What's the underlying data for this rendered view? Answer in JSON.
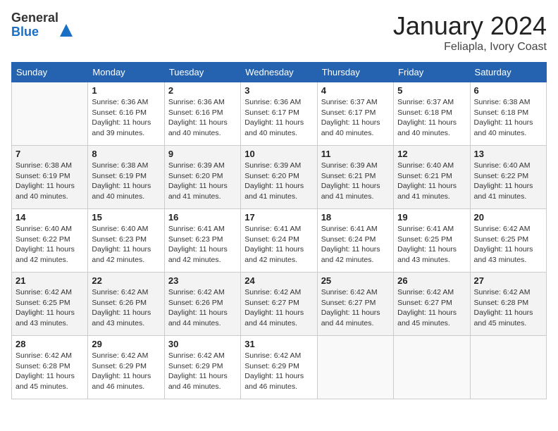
{
  "header": {
    "logo": {
      "general": "General",
      "blue": "Blue"
    },
    "title": "January 2024",
    "location": "Feliapla, Ivory Coast"
  },
  "weekdays": [
    "Sunday",
    "Monday",
    "Tuesday",
    "Wednesday",
    "Thursday",
    "Friday",
    "Saturday"
  ],
  "weeks": [
    [
      {
        "day": "",
        "sunrise": "",
        "sunset": "",
        "daylight": ""
      },
      {
        "day": "1",
        "sunrise": "Sunrise: 6:36 AM",
        "sunset": "Sunset: 6:16 PM",
        "daylight": "Daylight: 11 hours and 39 minutes."
      },
      {
        "day": "2",
        "sunrise": "Sunrise: 6:36 AM",
        "sunset": "Sunset: 6:16 PM",
        "daylight": "Daylight: 11 hours and 40 minutes."
      },
      {
        "day": "3",
        "sunrise": "Sunrise: 6:36 AM",
        "sunset": "Sunset: 6:17 PM",
        "daylight": "Daylight: 11 hours and 40 minutes."
      },
      {
        "day": "4",
        "sunrise": "Sunrise: 6:37 AM",
        "sunset": "Sunset: 6:17 PM",
        "daylight": "Daylight: 11 hours and 40 minutes."
      },
      {
        "day": "5",
        "sunrise": "Sunrise: 6:37 AM",
        "sunset": "Sunset: 6:18 PM",
        "daylight": "Daylight: 11 hours and 40 minutes."
      },
      {
        "day": "6",
        "sunrise": "Sunrise: 6:38 AM",
        "sunset": "Sunset: 6:18 PM",
        "daylight": "Daylight: 11 hours and 40 minutes."
      }
    ],
    [
      {
        "day": "7",
        "sunrise": "Sunrise: 6:38 AM",
        "sunset": "Sunset: 6:19 PM",
        "daylight": "Daylight: 11 hours and 40 minutes."
      },
      {
        "day": "8",
        "sunrise": "Sunrise: 6:38 AM",
        "sunset": "Sunset: 6:19 PM",
        "daylight": "Daylight: 11 hours and 40 minutes."
      },
      {
        "day": "9",
        "sunrise": "Sunrise: 6:39 AM",
        "sunset": "Sunset: 6:20 PM",
        "daylight": "Daylight: 11 hours and 41 minutes."
      },
      {
        "day": "10",
        "sunrise": "Sunrise: 6:39 AM",
        "sunset": "Sunset: 6:20 PM",
        "daylight": "Daylight: 11 hours and 41 minutes."
      },
      {
        "day": "11",
        "sunrise": "Sunrise: 6:39 AM",
        "sunset": "Sunset: 6:21 PM",
        "daylight": "Daylight: 11 hours and 41 minutes."
      },
      {
        "day": "12",
        "sunrise": "Sunrise: 6:40 AM",
        "sunset": "Sunset: 6:21 PM",
        "daylight": "Daylight: 11 hours and 41 minutes."
      },
      {
        "day": "13",
        "sunrise": "Sunrise: 6:40 AM",
        "sunset": "Sunset: 6:22 PM",
        "daylight": "Daylight: 11 hours and 41 minutes."
      }
    ],
    [
      {
        "day": "14",
        "sunrise": "Sunrise: 6:40 AM",
        "sunset": "Sunset: 6:22 PM",
        "daylight": "Daylight: 11 hours and 42 minutes."
      },
      {
        "day": "15",
        "sunrise": "Sunrise: 6:40 AM",
        "sunset": "Sunset: 6:23 PM",
        "daylight": "Daylight: 11 hours and 42 minutes."
      },
      {
        "day": "16",
        "sunrise": "Sunrise: 6:41 AM",
        "sunset": "Sunset: 6:23 PM",
        "daylight": "Daylight: 11 hours and 42 minutes."
      },
      {
        "day": "17",
        "sunrise": "Sunrise: 6:41 AM",
        "sunset": "Sunset: 6:24 PM",
        "daylight": "Daylight: 11 hours and 42 minutes."
      },
      {
        "day": "18",
        "sunrise": "Sunrise: 6:41 AM",
        "sunset": "Sunset: 6:24 PM",
        "daylight": "Daylight: 11 hours and 42 minutes."
      },
      {
        "day": "19",
        "sunrise": "Sunrise: 6:41 AM",
        "sunset": "Sunset: 6:25 PM",
        "daylight": "Daylight: 11 hours and 43 minutes."
      },
      {
        "day": "20",
        "sunrise": "Sunrise: 6:42 AM",
        "sunset": "Sunset: 6:25 PM",
        "daylight": "Daylight: 11 hours and 43 minutes."
      }
    ],
    [
      {
        "day": "21",
        "sunrise": "Sunrise: 6:42 AM",
        "sunset": "Sunset: 6:25 PM",
        "daylight": "Daylight: 11 hours and 43 minutes."
      },
      {
        "day": "22",
        "sunrise": "Sunrise: 6:42 AM",
        "sunset": "Sunset: 6:26 PM",
        "daylight": "Daylight: 11 hours and 43 minutes."
      },
      {
        "day": "23",
        "sunrise": "Sunrise: 6:42 AM",
        "sunset": "Sunset: 6:26 PM",
        "daylight": "Daylight: 11 hours and 44 minutes."
      },
      {
        "day": "24",
        "sunrise": "Sunrise: 6:42 AM",
        "sunset": "Sunset: 6:27 PM",
        "daylight": "Daylight: 11 hours and 44 minutes."
      },
      {
        "day": "25",
        "sunrise": "Sunrise: 6:42 AM",
        "sunset": "Sunset: 6:27 PM",
        "daylight": "Daylight: 11 hours and 44 minutes."
      },
      {
        "day": "26",
        "sunrise": "Sunrise: 6:42 AM",
        "sunset": "Sunset: 6:27 PM",
        "daylight": "Daylight: 11 hours and 45 minutes."
      },
      {
        "day": "27",
        "sunrise": "Sunrise: 6:42 AM",
        "sunset": "Sunset: 6:28 PM",
        "daylight": "Daylight: 11 hours and 45 minutes."
      }
    ],
    [
      {
        "day": "28",
        "sunrise": "Sunrise: 6:42 AM",
        "sunset": "Sunset: 6:28 PM",
        "daylight": "Daylight: 11 hours and 45 minutes."
      },
      {
        "day": "29",
        "sunrise": "Sunrise: 6:42 AM",
        "sunset": "Sunset: 6:29 PM",
        "daylight": "Daylight: 11 hours and 46 minutes."
      },
      {
        "day": "30",
        "sunrise": "Sunrise: 6:42 AM",
        "sunset": "Sunset: 6:29 PM",
        "daylight": "Daylight: 11 hours and 46 minutes."
      },
      {
        "day": "31",
        "sunrise": "Sunrise: 6:42 AM",
        "sunset": "Sunset: 6:29 PM",
        "daylight": "Daylight: 11 hours and 46 minutes."
      },
      {
        "day": "",
        "sunrise": "",
        "sunset": "",
        "daylight": ""
      },
      {
        "day": "",
        "sunrise": "",
        "sunset": "",
        "daylight": ""
      },
      {
        "day": "",
        "sunrise": "",
        "sunset": "",
        "daylight": ""
      }
    ]
  ]
}
